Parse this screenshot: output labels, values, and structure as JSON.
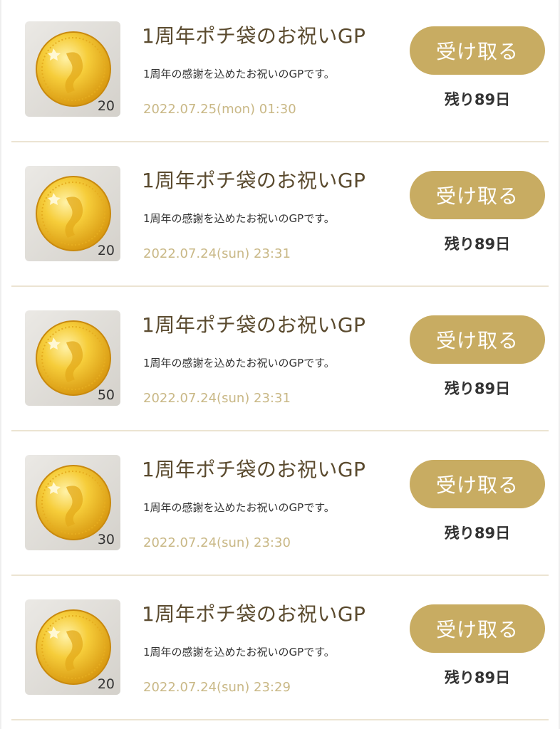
{
  "items": [
    {
      "icon": "gold-coin-icon",
      "amount": "20",
      "title": "1周年ポチ袋のお祝いGP",
      "description": "1周年の感謝を込めたお祝いのGPです。",
      "date": "2022.07.25(mon) 01:30",
      "button_label": "受け取る",
      "remaining": "残り89日"
    },
    {
      "icon": "gold-coin-icon",
      "amount": "20",
      "title": "1周年ポチ袋のお祝いGP",
      "description": "1周年の感謝を込めたお祝いのGPです。",
      "date": "2022.07.24(sun) 23:31",
      "button_label": "受け取る",
      "remaining": "残り89日"
    },
    {
      "icon": "gold-coin-icon",
      "amount": "50",
      "title": "1周年ポチ袋のお祝いGP",
      "description": "1周年の感謝を込めたお祝いのGPです。",
      "date": "2022.07.24(sun) 23:31",
      "button_label": "受け取る",
      "remaining": "残り89日"
    },
    {
      "icon": "gold-coin-icon",
      "amount": "30",
      "title": "1周年ポチ袋のお祝いGP",
      "description": "1周年の感謝を込めたお祝いのGPです。",
      "date": "2022.07.24(sun) 23:30",
      "button_label": "受け取る",
      "remaining": "残り89日"
    },
    {
      "icon": "gold-coin-icon",
      "amount": "20",
      "title": "1周年ポチ袋のお祝いGP",
      "description": "1周年の感謝を込めたお祝いのGPです。",
      "date": "2022.07.24(sun) 23:29",
      "button_label": "受け取る",
      "remaining": "残り89日"
    }
  ],
  "colors": {
    "button": "#c8ac62",
    "title": "#5a4a2e",
    "date": "#c9b886",
    "divider": "#ece4d2",
    "coin": "#f2c227"
  }
}
